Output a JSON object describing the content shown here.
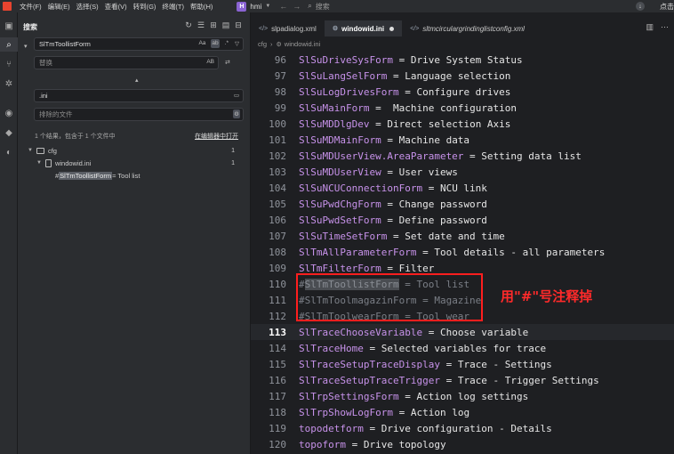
{
  "titlebar": {
    "menu": [
      "文件(F)",
      "编辑(E)",
      "选择(S)",
      "查看(V)",
      "转到(G)",
      "终端(T)",
      "帮助(H)"
    ],
    "project_initial": "H",
    "project_name": "hmi",
    "search_label": "搜索",
    "right_text": "点击"
  },
  "sidebar": {
    "title": "搜索",
    "search_value": "SlTmToollistForm",
    "search_opts": [
      "Aa",
      "ab",
      ".*"
    ],
    "replace_placeholder": "替换",
    "replace_opt": "AB",
    "include_value": ".ini",
    "exclude_placeholder": "排除的文件",
    "results_info": "1 个结果，包含于 1 个文件中",
    "open_in_editor": "在编辑器中打开",
    "tree": {
      "folder": "cfg",
      "folder_count": "1",
      "file": "windowid.ini",
      "file_count": "1",
      "match_prefix": "#",
      "match_hl": "SlTmToollistForm",
      "match_suffix": " = Tool list"
    }
  },
  "editor": {
    "tabs": [
      {
        "label": "slpadialog.xml",
        "active": false
      },
      {
        "label": "windowid.ini",
        "active": true,
        "modified": true
      },
      {
        "label": "sltmcirculargrindinglistconfig.xml",
        "active": false
      }
    ],
    "breadcrumb": [
      "cfg",
      "windowid.ini"
    ],
    "lines": [
      {
        "no": "96",
        "key": "SlSuDriveSysForm",
        "rest": " = Drive System Status"
      },
      {
        "no": "97",
        "key": "SlSuLangSelForm",
        "rest": " = Language selection"
      },
      {
        "no": "98",
        "key": "SlSuLogDrivesForm",
        "rest": " = Configure drives"
      },
      {
        "no": "99",
        "key": "SlSuMainForm",
        "rest": " =  Machine configuration"
      },
      {
        "no": "100",
        "key": "SlSuMDDlgDev",
        "rest": " = Direct selection Axis"
      },
      {
        "no": "101",
        "key": "SlSuMDMainForm",
        "rest": " = Machine data"
      },
      {
        "no": "102",
        "key": "SlSuMDUserView.AreaParameter",
        "rest": " = Setting data list"
      },
      {
        "no": "103",
        "key": "SlSuMDUserView",
        "rest": " = User views"
      },
      {
        "no": "104",
        "key": "SlSuNCUConnectionForm",
        "rest": " = NCU link"
      },
      {
        "no": "105",
        "key": "SlSuPwdChgForm",
        "rest": " = Change password"
      },
      {
        "no": "106",
        "key": "SlSuPwdSetForm",
        "rest": " = Define password"
      },
      {
        "no": "107",
        "key": "SlSuTimeSetForm",
        "rest": " = Set date and time"
      },
      {
        "no": "108",
        "key": "SlTmAllParameterForm",
        "rest": " = Tool details - all parameters"
      },
      {
        "no": "109",
        "key": "SlTmFilterForm",
        "rest": " = Filter"
      },
      {
        "no": "110",
        "comment": true,
        "hash": "#",
        "hl": "SlTmToollistForm",
        "rest": " = Tool list"
      },
      {
        "no": "111",
        "comment": true,
        "hash": "#",
        "hl": "",
        "rest": "SlTmToolmagazinForm = Magazine"
      },
      {
        "no": "112",
        "comment": true,
        "hash": "#",
        "hl": "",
        "rest": "SlTmToolwearForm = Tool wear"
      },
      {
        "no": "113",
        "key": "SlTraceChooseVariable",
        "rest": " = Choose variable",
        "current": true
      },
      {
        "no": "114",
        "key": "SlTraceHome",
        "rest": " = Selected variables for trace"
      },
      {
        "no": "115",
        "key": "SlTraceSetupTraceDisplay",
        "rest": " = Trace - Settings"
      },
      {
        "no": "116",
        "key": "SlTraceSetupTraceTrigger",
        "rest": " = Trace - Trigger Settings"
      },
      {
        "no": "117",
        "key": "SlTrpSettingsForm",
        "rest": " = Action log settings"
      },
      {
        "no": "118",
        "key": "SlTrpShowLogForm",
        "rest": " = Action log"
      },
      {
        "no": "119",
        "key": "topodetform",
        "rest": " = Drive configuration - Details"
      },
      {
        "no": "120",
        "key": "topoform",
        "rest": " = Drive topology"
      }
    ]
  },
  "annotation": "用\"#\"号注释掉",
  "colors": {
    "key": "#c792ea",
    "comment": "#7b7f87",
    "annotation": "#ff2a2a",
    "accent_logo": "#e8442f"
  }
}
